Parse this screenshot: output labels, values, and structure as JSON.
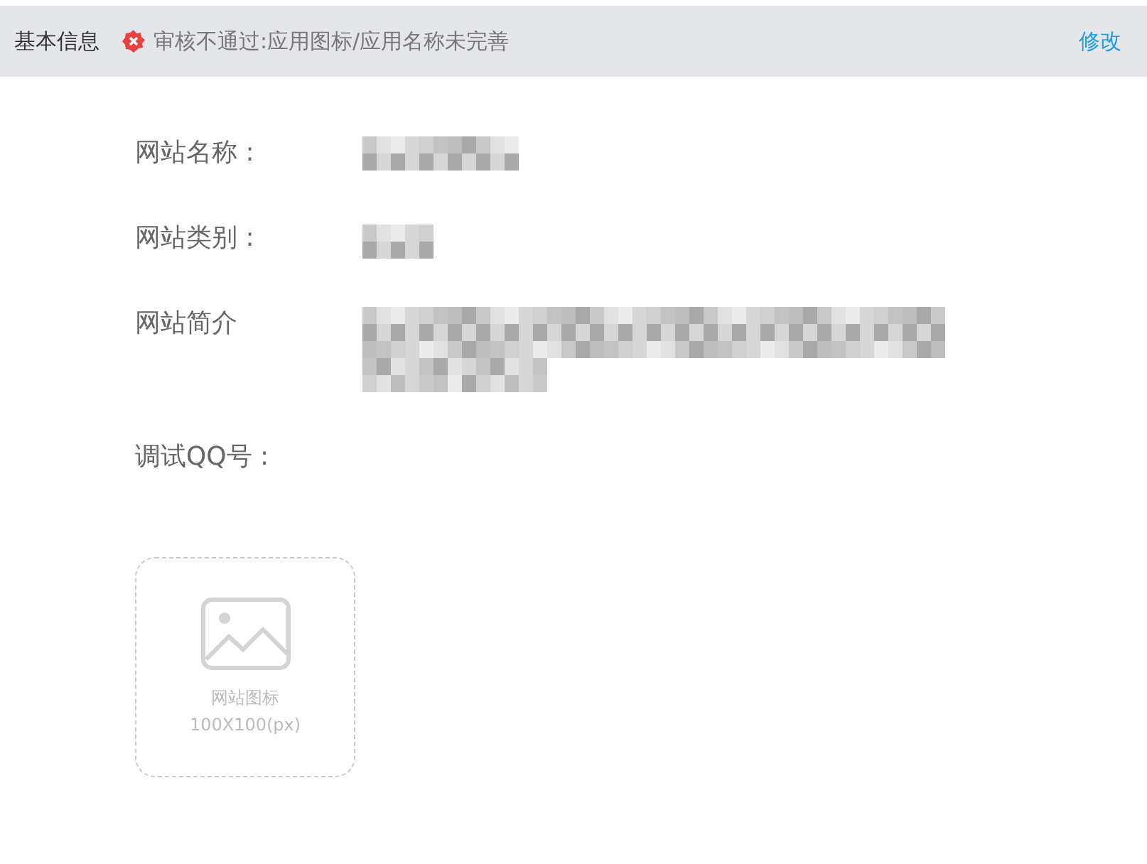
{
  "header": {
    "title": "基本信息",
    "status": {
      "kind": "rejected",
      "text": "审核不通过:应用图标/应用名称未完善"
    },
    "action": "修改"
  },
  "fields": [
    {
      "label": "网站名称 :",
      "kind": "short"
    },
    {
      "label": "网站类别 :",
      "kind": "tiny"
    },
    {
      "label": "网站简介",
      "kind": "paragraph"
    },
    {
      "label": "调试QQ号 :",
      "kind": "empty"
    }
  ],
  "upload": {
    "title": "网站图标",
    "size": "100X100(px)"
  }
}
